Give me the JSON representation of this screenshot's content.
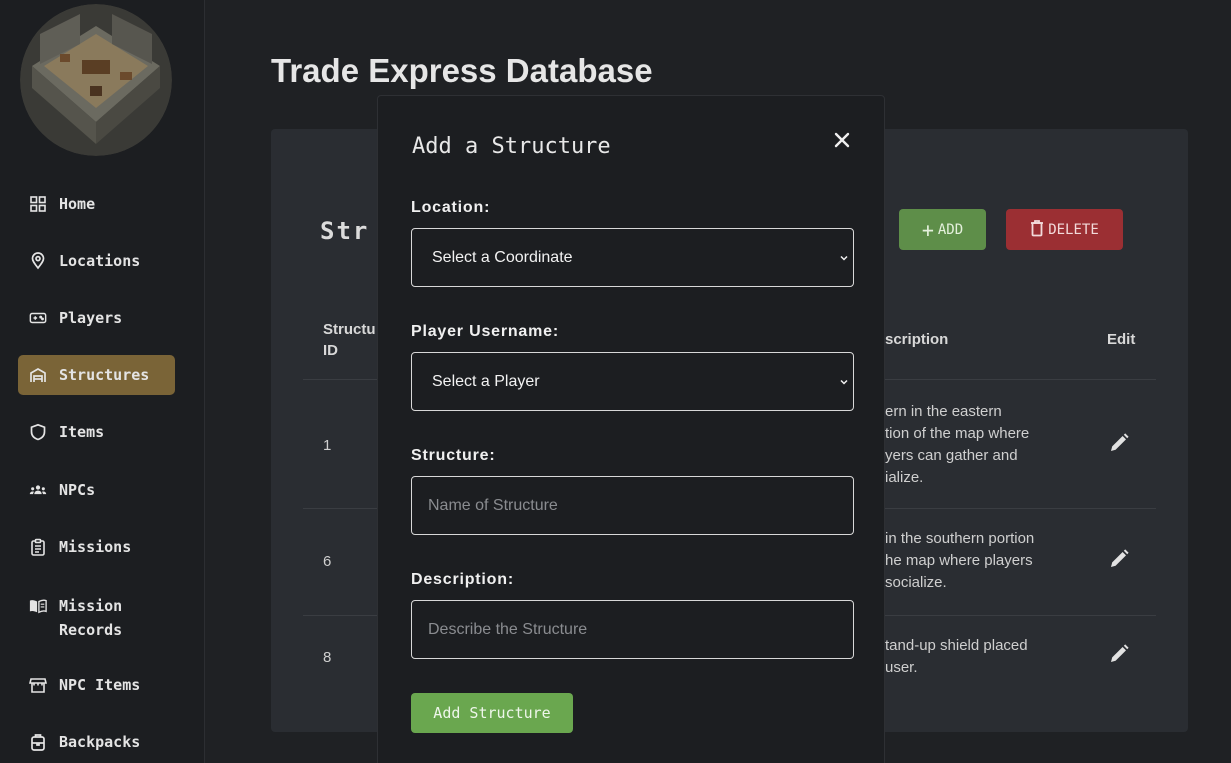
{
  "sidebar": {
    "items": [
      {
        "label": "Home",
        "icon": "grid-icon"
      },
      {
        "label": "Locations",
        "icon": "location-pin-icon"
      },
      {
        "label": "Players",
        "icon": "gamepad-icon"
      },
      {
        "label": "Structures",
        "icon": "warehouse-icon",
        "active": true
      },
      {
        "label": "Items",
        "icon": "shield-icon"
      },
      {
        "label": "NPCs",
        "icon": "group-icon"
      },
      {
        "label": "Missions",
        "icon": "clipboard-icon"
      },
      {
        "label": "Mission Records",
        "icon": "book-icon"
      },
      {
        "label": "NPC Items",
        "icon": "storefront-icon"
      },
      {
        "label": "Backpacks",
        "icon": "backpack-icon"
      }
    ]
  },
  "header": {
    "title": "Trade Express Database"
  },
  "card": {
    "title": "Str",
    "add_label": "ADD",
    "delete_label": "DELETE",
    "columns": {
      "id": "Structu ID",
      "description": "scription",
      "edit": "Edit"
    },
    "rows": [
      {
        "id": "1",
        "description": [
          "ern in the eastern",
          "tion of the map where",
          "yers can gather and",
          "ialize."
        ]
      },
      {
        "id": "6",
        "description": [
          "in the southern portion",
          "he map where players",
          "socialize."
        ]
      },
      {
        "id": "8",
        "description": [
          "tand-up shield placed",
          "user."
        ]
      }
    ]
  },
  "modal": {
    "title": "Add a Structure",
    "location_label": "Location:",
    "location_value": "Select a Coordinate",
    "player_label": "Player Username:",
    "player_value": "Select a Player",
    "structure_label": "Structure:",
    "structure_placeholder": "Name of Structure",
    "description_label": "Description:",
    "description_placeholder": "Describe the Structure",
    "submit_label": "Add Structure"
  },
  "colors": {
    "active_nav": "#7a6437",
    "add_button": "#5e8e49",
    "delete_button": "#9b2f33",
    "submit_button": "#6aa74f"
  }
}
